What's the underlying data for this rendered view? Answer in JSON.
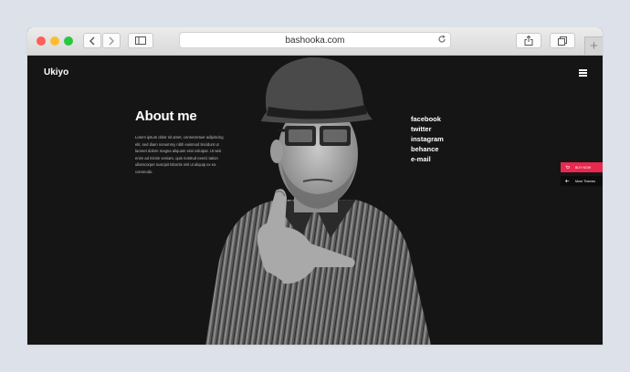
{
  "browser": {
    "url": "bashooka.com"
  },
  "site": {
    "logo": "Ukiyo",
    "about": {
      "title": "About me",
      "body": "Lorem ipsum dolor sit amet, consectetuer adipiscing elit, sed diam nonummy nibh euismod tincidunt ut laoreet dolore magna aliquam erat volutpat. Ut wisi enim ad minim veniam, quis nostrud exerci tation ullamcorper suscipit lobortis nisl ut aliquip ex ea commodo."
    },
    "social": [
      "facebook",
      "twitter",
      "instagram",
      "behance",
      "e-mail"
    ],
    "side": {
      "buy_label": "BUY NOW",
      "more_label": "More Themes"
    }
  },
  "colors": {
    "page_bg": "#151515",
    "accent": "#e8284f"
  },
  "icons": [
    "back-icon",
    "forward-icon",
    "sidebar-icon",
    "reload-icon",
    "share-icon",
    "tabs-icon",
    "new-tab-icon",
    "hamburger-icon",
    "cart-icon",
    "arrow-left-icon"
  ]
}
